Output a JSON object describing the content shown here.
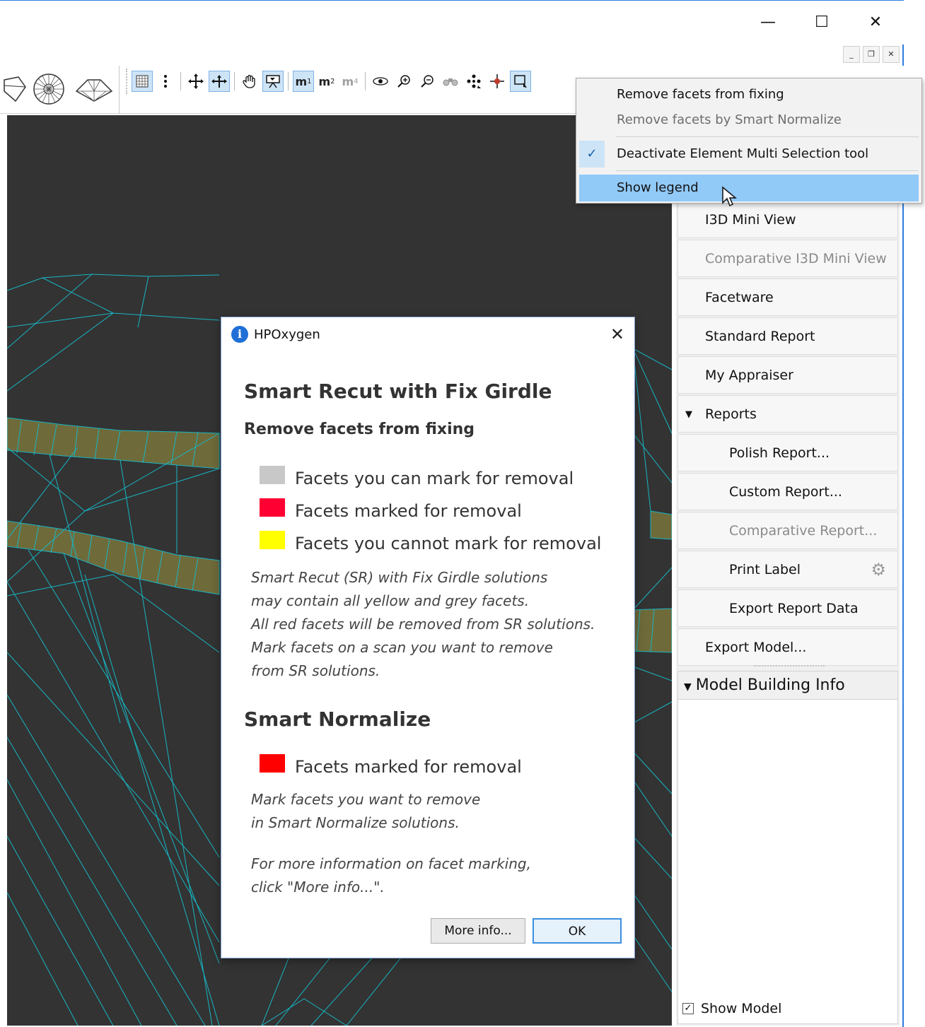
{
  "window": {
    "controls": {
      "minimize": "—",
      "maximize": "☐",
      "close": "✕"
    },
    "mdi_controls": {
      "minimize": "_",
      "restore": "❐",
      "close": "✕"
    }
  },
  "toolbar": {
    "m1": "m",
    "m1_sub": "1",
    "m2": "m",
    "m2_sub": "2",
    "m4": "m",
    "m4_sub": "4"
  },
  "context_menu": {
    "items": [
      {
        "label": "Remove facets from fixing",
        "state": "normal"
      },
      {
        "label": "Remove facets by Smart Normalize",
        "state": "disabled"
      },
      {
        "label": "Deactivate Element Multi Selection tool",
        "state": "checked"
      },
      {
        "label": "Show legend",
        "state": "hover"
      }
    ],
    "check_glyph": "✓"
  },
  "right_panel": {
    "items": [
      {
        "label": "I3D Mini View",
        "disabled": false
      },
      {
        "label": "Comparative I3D Mini View",
        "disabled": true
      },
      {
        "label": "Facetware",
        "disabled": false
      },
      {
        "label": "Standard Report",
        "disabled": false
      },
      {
        "label": "My Appraiser",
        "disabled": false
      },
      {
        "label": "Reports",
        "disabled": false
      },
      {
        "label": "Polish Report...",
        "disabled": false
      },
      {
        "label": "Custom Report...",
        "disabled": false
      },
      {
        "label": "Comparative Report...",
        "disabled": true
      },
      {
        "label": "Print Label",
        "disabled": false
      },
      {
        "label": "Export Report Data",
        "disabled": false
      },
      {
        "label": "Export Model...",
        "disabled": false
      }
    ],
    "model_building_info": "Model Building Info",
    "show_model": "Show Model",
    "show_model_checked": "✓",
    "expand_arrow": "▼"
  },
  "dialog": {
    "title": "HPOxygen",
    "info_glyph": "i",
    "close": "✕",
    "heading": "Smart Recut with Fix Girdle",
    "section1": "Remove facets from fixing",
    "legend1": [
      {
        "label": "Facets you can mark for removal",
        "color": "#c8c8c8"
      },
      {
        "label": "Facets marked for removal",
        "color": "#ff0033"
      },
      {
        "label": "Facets you cannot mark for removal",
        "color": "#ffff00"
      }
    ],
    "note1": "Smart Recut (SR) with Fix Girdle solutions\nmay contain all yellow and grey facets.\nAll red facets will be removed from SR solutions.\nMark facets on a scan you want to remove\nfrom SR solutions.",
    "section2": "Smart Normalize",
    "legend2": [
      {
        "label": "Facets marked for removal",
        "color": "#ff0000"
      }
    ],
    "note2": "Mark facets you want to remove\nin Smart Normalize solutions.",
    "note3": "For more information on facet marking,\nclick \"More info...\".",
    "more_info_button": "More info...",
    "ok_button": "OK"
  },
  "colors": {
    "viewport_bg": "#333333",
    "wire": "#17b6c4",
    "girdle_fill": "#6f6a3a",
    "accent": "#2b7de1"
  }
}
